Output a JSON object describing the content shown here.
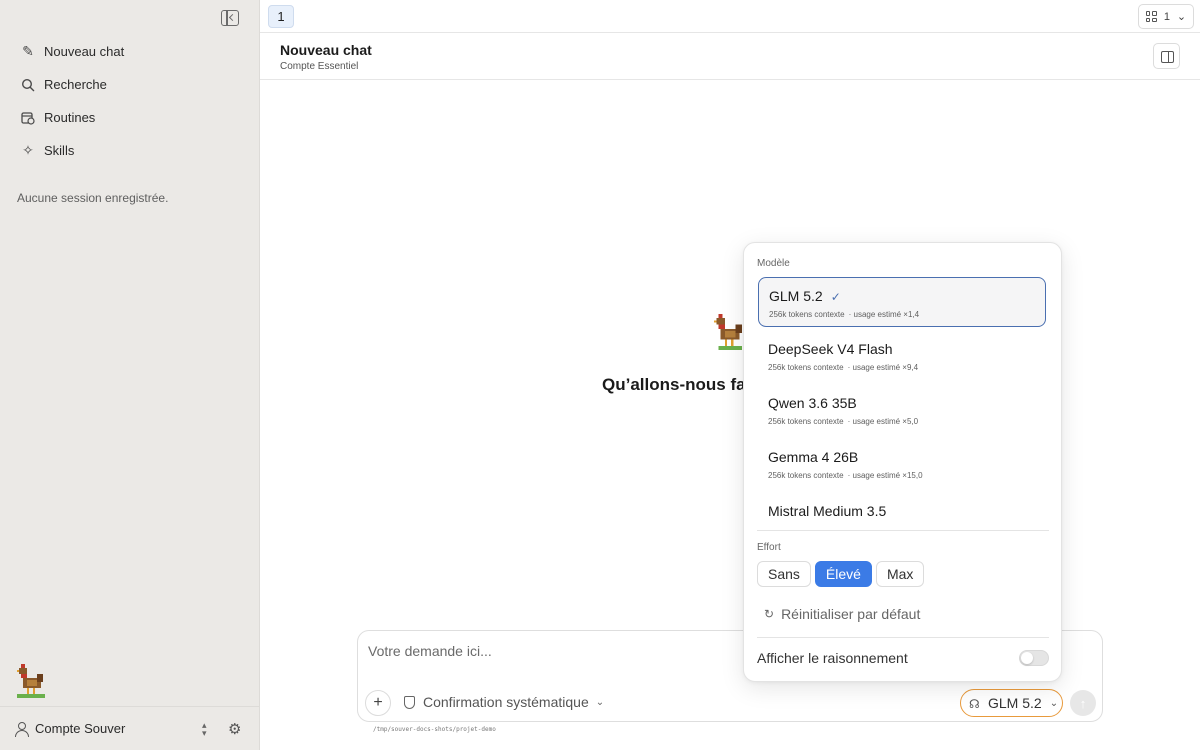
{
  "sidebar": {
    "items": [
      {
        "label": "Nouveau chat",
        "icon": "pencil-icon"
      },
      {
        "label": "Recherche",
        "icon": "search-icon"
      },
      {
        "label": "Routines",
        "icon": "calendar-clock-icon"
      },
      {
        "label": "Skills",
        "icon": "sparkle-icon"
      }
    ],
    "empty_message": "Aucune session enregistrée.",
    "account_name": "Compte Souver"
  },
  "topbar": {
    "tab_label": "1",
    "layout_count": "1"
  },
  "header": {
    "title": "Nouveau chat",
    "subtitle": "Compte Essentiel"
  },
  "main": {
    "greeting": "Qu’allons-nous fair"
  },
  "composer": {
    "placeholder": "Votre demande ici...",
    "confirmation_label": "Confirmation systématique",
    "selected_model": "GLM 5.2",
    "path": "/tmp/souver-docs-shots/projet-demo"
  },
  "model_popover": {
    "section_label": "Modèle",
    "models": [
      {
        "name": "GLM 5.2",
        "context": "256k tokens contexte",
        "usage": "· usage estimé ×1,4",
        "selected": true
      },
      {
        "name": "DeepSeek V4 Flash",
        "context": "256k tokens contexte",
        "usage": "· usage estimé ×9,4",
        "selected": false
      },
      {
        "name": "Qwen 3.6 35B",
        "context": "256k tokens contexte",
        "usage": "· usage estimé ×5,0",
        "selected": false
      },
      {
        "name": "Gemma 4 26B",
        "context": "256k tokens contexte",
        "usage": "· usage estimé ×15,0",
        "selected": false
      },
      {
        "name": "Mistral Medium 3.5",
        "context": "",
        "usage": "",
        "selected": false
      }
    ],
    "effort_label": "Effort",
    "effort_options": [
      "Sans",
      "Élevé",
      "Max"
    ],
    "effort_selected": "Élevé",
    "reset_label": "Réinitialiser par défaut",
    "reasoning_label": "Afficher le raisonnement",
    "reasoning_enabled": false
  },
  "colors": {
    "accent": "#3b7be6",
    "selected_border": "#4a6fb0",
    "model_button_border": "#e89a3c",
    "sidebar_bg": "#ebe9e6"
  }
}
